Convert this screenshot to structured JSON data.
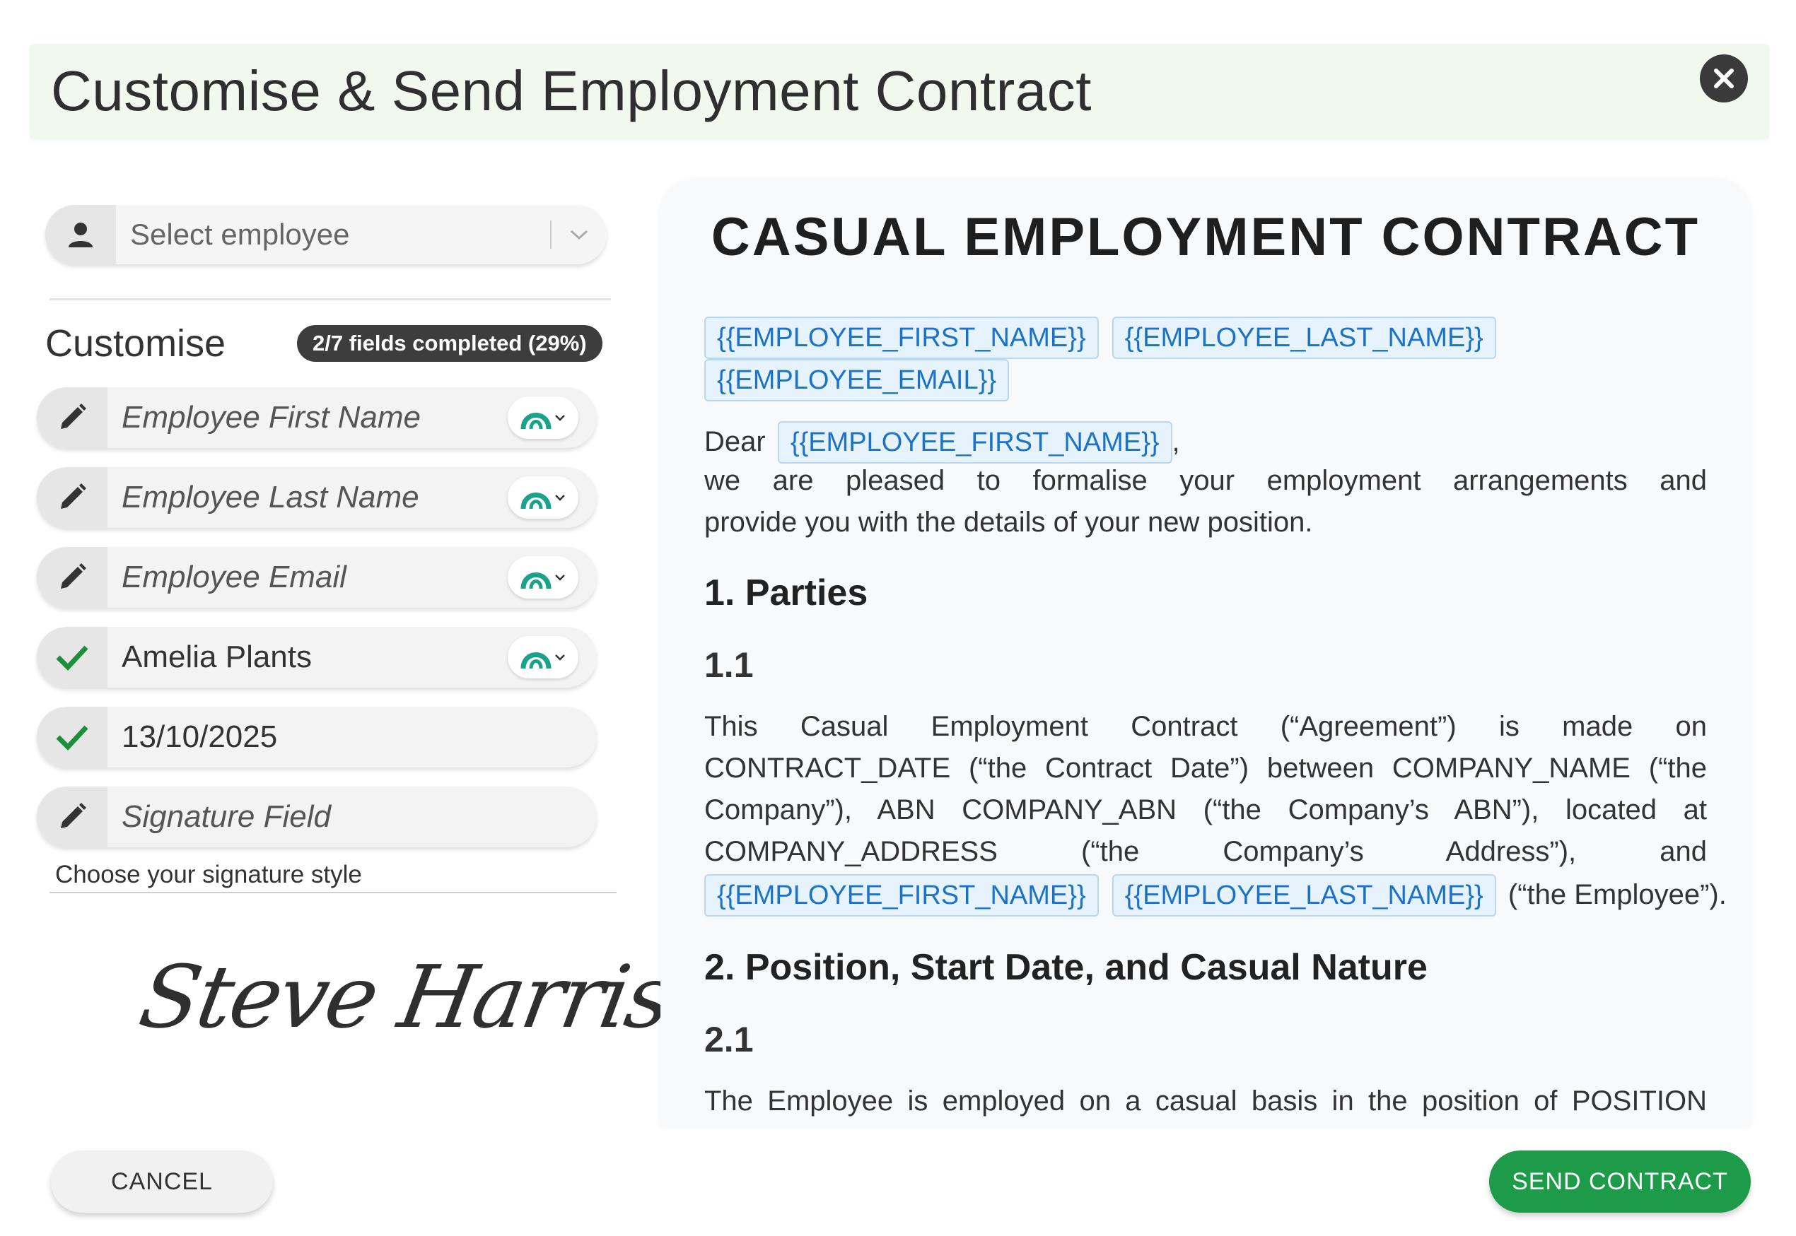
{
  "dialog": {
    "title": "Customise & Send Employment Contract",
    "close_icon": "close-icon"
  },
  "employee_select": {
    "placeholder": "Select employee",
    "icon": "person-icon"
  },
  "customise": {
    "label": "Customise",
    "badge": "2/7 fields completed (29%)",
    "fields": [
      {
        "text": "Employee First Name",
        "status": "pending",
        "icon": "pencil-icon",
        "has_source_toggle": true
      },
      {
        "text": "Employee Last Name",
        "status": "pending",
        "icon": "pencil-icon",
        "has_source_toggle": true
      },
      {
        "text": "Employee Email",
        "status": "pending",
        "icon": "pencil-icon",
        "has_source_toggle": true
      },
      {
        "text": "Amelia Plants",
        "status": "completed",
        "icon": "check-icon",
        "has_source_toggle": true
      },
      {
        "text": "13/10/2025",
        "status": "completed",
        "icon": "check-icon",
        "has_source_toggle": false
      },
      {
        "text": "Signature Field",
        "status": "pending",
        "icon": "pencil-icon",
        "has_source_toggle": false
      }
    ],
    "signature_style_label": "Choose your signature style",
    "signature_preview": "Steve Harris"
  },
  "document": {
    "title": "CASUAL EMPLOYMENT CONTRACT",
    "tokens": {
      "first_name": "{{EMPLOYEE_FIRST_NAME}}",
      "last_name": "{{EMPLOYEE_LAST_NAME}}",
      "email": "{{EMPLOYEE_EMAIL}}"
    },
    "dear": "Dear",
    "comma": ",",
    "intro_line1": "we are pleased to formalise your employment arrangements and",
    "intro_line2": "provide you with the details of your new position.",
    "section1_heading": "1. Parties",
    "clause_1_1": "1.1",
    "p1_line1": "This Casual Employment Contract (“Agreement”) is made on",
    "p1_line2": "CONTRACT_DATE (“the Contract Date”) between COMPANY_NAME (“the",
    "p1_line3": "Company”), ABN COMPANY_ABN (“the Company’s ABN”), located at",
    "p1_line4": "COMPANY_ADDRESS (“the Company’s Address”), and",
    "p1_line5_suffix": "(“the Employee”).",
    "section2_heading": "2. Position, Start Date, and Casual Nature",
    "clause_2_1": "2.1",
    "p2_line1": "The Employee is employed on a casual basis in the position of POSITION"
  },
  "footer": {
    "cancel": "CANCEL",
    "send": "SEND CONTRACT"
  },
  "colors": {
    "header_bg": "#f1f8ee",
    "send_green": "#1d9b48",
    "check_green": "#1e8e3e",
    "token_blue": "#1a73c9",
    "source_icon_teal": "#1aa38a"
  }
}
